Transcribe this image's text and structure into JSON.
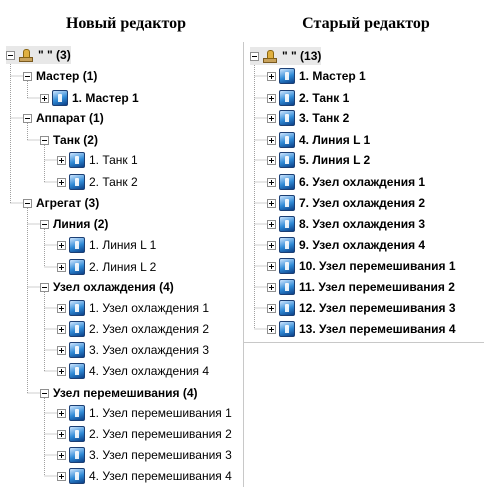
{
  "left": {
    "title": "Новый редактор",
    "rows": [
      {
        "text": "\"                         \" (3)",
        "toggle": "minus",
        "icon": "root",
        "bold": true,
        "selected": true
      },
      {
        "text": "Мастер (1)",
        "toggle": "minus",
        "icon": "none",
        "bold": true
      },
      {
        "text": "1. Мастер 1",
        "toggle": "plus",
        "icon": "node",
        "bold": true
      },
      {
        "text": "Аппарат (1)",
        "toggle": "minus",
        "icon": "none",
        "bold": true
      },
      {
        "text": "Танк (2)",
        "toggle": "minus",
        "icon": "none",
        "bold": true
      },
      {
        "text": "1. Танк 1",
        "toggle": "plus",
        "icon": "node",
        "bold": false
      },
      {
        "text": "2. Танк 2",
        "toggle": "plus",
        "icon": "node",
        "bold": false
      },
      {
        "text": "Агрегат (3)",
        "toggle": "minus",
        "icon": "none",
        "bold": true
      },
      {
        "text": "Линия (2)",
        "toggle": "minus",
        "icon": "none",
        "bold": true
      },
      {
        "text": "1. Линия L 1",
        "toggle": "plus",
        "icon": "node",
        "bold": false
      },
      {
        "text": "2. Линия L 2",
        "toggle": "plus",
        "icon": "node",
        "bold": false
      },
      {
        "text": "Узел охлаждения (4)",
        "toggle": "minus",
        "icon": "none",
        "bold": true
      },
      {
        "text": "1. Узел охлаждения 1",
        "toggle": "plus",
        "icon": "node",
        "bold": false
      },
      {
        "text": "2. Узел охлаждения 2",
        "toggle": "plus",
        "icon": "node",
        "bold": false
      },
      {
        "text": "3. Узел охлаждения 3",
        "toggle": "plus",
        "icon": "node",
        "bold": false
      },
      {
        "text": "4. Узел охлаждения 4",
        "toggle": "plus",
        "icon": "node",
        "bold": false
      },
      {
        "text": "Узел перемешивания (4)",
        "toggle": "minus",
        "icon": "none",
        "bold": true
      },
      {
        "text": "1. Узел перемешивания 1",
        "toggle": "plus",
        "icon": "node",
        "bold": false
      },
      {
        "text": "2. Узел перемешивания 2",
        "toggle": "plus",
        "icon": "node",
        "bold": false
      },
      {
        "text": "3. Узел перемешивания 3",
        "toggle": "plus",
        "icon": "node",
        "bold": false
      },
      {
        "text": "4. Узел перемешивания 4",
        "toggle": "plus",
        "icon": "node",
        "bold": false
      }
    ]
  },
  "right": {
    "title": "Старый редактор",
    "rows": [
      {
        "text": "\"                         \" (13)",
        "toggle": "minus",
        "icon": "root",
        "bold": true,
        "selected": true
      },
      {
        "text": "1. Мастер 1",
        "toggle": "plus",
        "icon": "node",
        "bold": true
      },
      {
        "text": "2. Танк 1",
        "toggle": "plus",
        "icon": "node",
        "bold": true
      },
      {
        "text": "3. Танк 2",
        "toggle": "plus",
        "icon": "node",
        "bold": true
      },
      {
        "text": "4. Линия L 1",
        "toggle": "plus",
        "icon": "node",
        "bold": true
      },
      {
        "text": "5. Линия L 2",
        "toggle": "plus",
        "icon": "node",
        "bold": true
      },
      {
        "text": "6. Узел охлаждения 1",
        "toggle": "plus",
        "icon": "node",
        "bold": true
      },
      {
        "text": "7. Узел охлаждения 2",
        "toggle": "plus",
        "icon": "node",
        "bold": true
      },
      {
        "text": "8. Узел охлаждения 3",
        "toggle": "plus",
        "icon": "node",
        "bold": true
      },
      {
        "text": "9. Узел охлаждения 4",
        "toggle": "plus",
        "icon": "node",
        "bold": true
      },
      {
        "text": "10. Узел перемешивания 1",
        "toggle": "plus",
        "icon": "node",
        "bold": true
      },
      {
        "text": "11. Узел перемешивания 2",
        "toggle": "plus",
        "icon": "node",
        "bold": true
      },
      {
        "text": "12. Узел перемешивания 3",
        "toggle": "plus",
        "icon": "node",
        "bold": true
      },
      {
        "text": "13. Узел перемешивания 4",
        "toggle": "plus",
        "icon": "node",
        "bold": true
      }
    ]
  }
}
